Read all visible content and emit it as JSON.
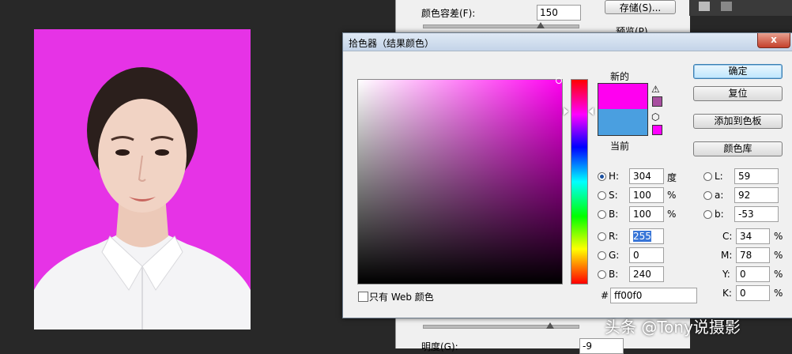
{
  "photo": {
    "background_color": "#e633e6"
  },
  "bg_dialog": {
    "fuzziness_label": "颜色容差(F):",
    "fuzziness_value": "150",
    "save_button": "存储(S)...",
    "preview_label": "预览(P)",
    "lightness_label": "明度(G):",
    "lightness_value": "-9"
  },
  "picker": {
    "title": "拾色器（结果颜色）",
    "close_label": "x",
    "new_label": "新的",
    "current_label": "当前",
    "new_color": "#ff00f0",
    "current_color": "#4a9fe0",
    "ok_button": "确定",
    "reset_button": "复位",
    "add_swatch_button": "添加到色板",
    "color_libraries_button": "颜色库",
    "web_only_label": "只有 Web 颜色",
    "hex_prefix": "#",
    "hex_value": "ff00f0",
    "hsb": [
      {
        "label": "H:",
        "value": "304",
        "unit": "度",
        "selected": true
      },
      {
        "label": "S:",
        "value": "100",
        "unit": "%",
        "selected": false
      },
      {
        "label": "B:",
        "value": "100",
        "unit": "%",
        "selected": false
      }
    ],
    "rgb": [
      {
        "label": "R:",
        "value": "255"
      },
      {
        "label": "G:",
        "value": "0"
      },
      {
        "label": "B:",
        "value": "240"
      }
    ],
    "lab": [
      {
        "label": "L:",
        "value": "59"
      },
      {
        "label": "a:",
        "value": "92"
      },
      {
        "label": "b:",
        "value": "-53"
      }
    ],
    "cmyk": [
      {
        "label": "C:",
        "value": "34",
        "unit": "%"
      },
      {
        "label": "M:",
        "value": "78",
        "unit": "%"
      },
      {
        "label": "Y:",
        "value": "0",
        "unit": "%"
      },
      {
        "label": "K:",
        "value": "0",
        "unit": "%"
      }
    ]
  },
  "watermark": "头条 @Tony说摄影"
}
